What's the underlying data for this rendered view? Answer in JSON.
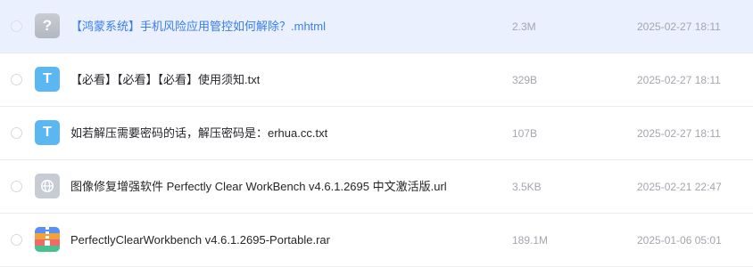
{
  "files": [
    {
      "name": "【鸿蒙系统】手机风险应用管控如何解除？.mhtml",
      "size": "2.3M",
      "date": "2025-02-27 18:11",
      "icon": "unknown-file-icon",
      "icon_glyph": "?",
      "selected": true
    },
    {
      "name": "【必看】【必看】【必看】使用须知.txt",
      "size": "329B",
      "date": "2025-02-27 18:11",
      "icon": "text-file-icon",
      "icon_glyph": "T",
      "selected": false
    },
    {
      "name": "如若解压需要密码的话，解压密码是：erhua.cc.txt",
      "size": "107B",
      "date": "2025-02-27 18:11",
      "icon": "text-file-icon",
      "icon_glyph": "T",
      "selected": false
    },
    {
      "name": "图像修复增强软件 Perfectly Clear WorkBench v4.6.1.2695 中文激活版.url",
      "size": "3.5KB",
      "date": "2025-02-21 22:47",
      "icon": "web-link-icon",
      "selected": false
    },
    {
      "name": "PerfectlyClearWorkbench v4.6.1.2695-Portable.rar",
      "size": "189.1M",
      "date": "2025-01-06 05:01",
      "icon": "archive-file-icon",
      "selected": false
    }
  ],
  "colors": {
    "selected_bg": "#eaf0fe",
    "selected_text": "#3a7df2",
    "txt_icon": "#5bb7f1",
    "meta_text": "#a3a6ad"
  }
}
